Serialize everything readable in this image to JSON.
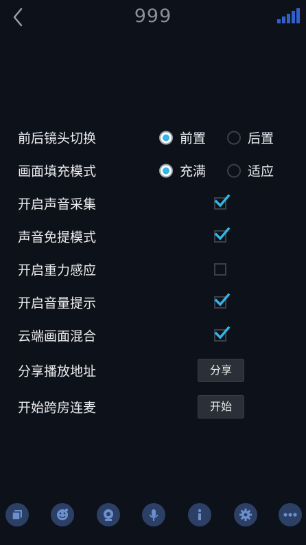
{
  "header": {
    "title": "999",
    "back_icon": "back-arrow-icon",
    "signal_icon": "signal-strength-icon"
  },
  "settings": {
    "camera": {
      "label": "前后镜头切换",
      "options": [
        "前置",
        "后置"
      ],
      "selected": "前置"
    },
    "fill_mode": {
      "label": "画面填充模式",
      "options": [
        "充满",
        "适应"
      ],
      "selected": "充满"
    },
    "audio_capture": {
      "label": "开启声音采集",
      "checked": true
    },
    "handsfree": {
      "label": "声音免提模式",
      "checked": true
    },
    "gravity": {
      "label": "开启重力感应",
      "checked": false
    },
    "volume_hint": {
      "label": "开启音量提示",
      "checked": true
    },
    "cloud_mix": {
      "label": "云端画面混合",
      "checked": true
    },
    "share": {
      "label": "分享播放地址",
      "button": "分享"
    },
    "pk": {
      "label": "开始跨房连麦",
      "button": "开始"
    }
  },
  "toolbar": {
    "icons": [
      "screen-icon",
      "beauty-icon",
      "camera-icon",
      "microphone-icon",
      "info-icon",
      "settings-icon",
      "more-icon"
    ]
  },
  "colors": {
    "background": "#0d1119",
    "accent": "#33b5e5",
    "toolbar_button": "#2c4066",
    "toolbar_glyph": "#6c8fd0",
    "signal": "#2f62c8"
  }
}
